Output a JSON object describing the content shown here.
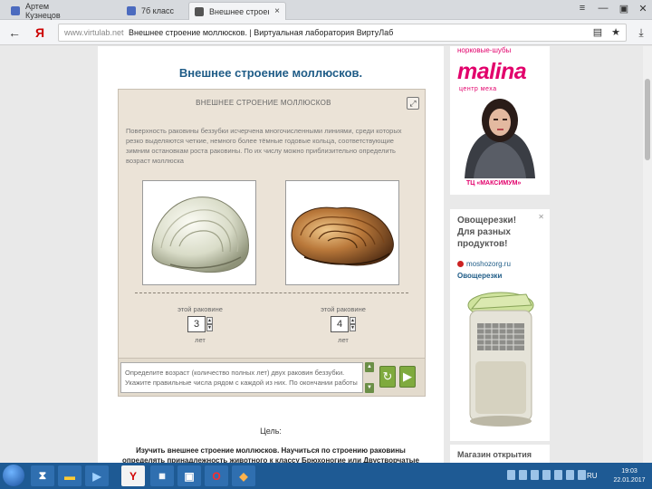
{
  "tabs": [
    {
      "label": "Артем Кузнецов",
      "color": "#4c6bbf"
    },
    {
      "label": "7б класс",
      "color": "#4c6bbf"
    },
    {
      "label": "Внешнее строение молл",
      "color": "#555555"
    }
  ],
  "window_icons": {
    "menu": "≡",
    "minimize": "—",
    "restore": "▣",
    "close": "✕"
  },
  "address": {
    "domain": "www.virtulab.net",
    "page_title": "Внешнее строение моллюсков. | Виртуальная лаборатория ВиртуЛаб"
  },
  "page": {
    "heading": "Внешнее строение моллюсков.",
    "lab": {
      "title": "ВНЕШНЕЕ СТРОЕНИЕ МОЛЛЮСКОВ",
      "description": "Поверхность раковины беззубки исчерчена многочисленными линиями, среди которых резко выделяются четкие, немного более тёмные годовые кольца, соответствующие зимним остановкам роста раковины. По их числу можно приблизительно определить возраст моллюска",
      "shells": [
        {
          "label": "этой раковине",
          "value": "3",
          "unit": "лет"
        },
        {
          "label": "этой раковине",
          "value": "4",
          "unit": "лет"
        }
      ],
      "instruction": "Определите возраст (количество полных лет) двух раковин беззубки. Укажите правильные числа рядом с каждой из них. По окончании работы"
    },
    "goal_label": "Цель:",
    "goal_text": "Изучить внешнее строение моллюсков. Научиться по строению раковины определять принадлежность животного к классу Брюхоногие или Двустворчатые моллюски. Научиться"
  },
  "ads": {
    "ad1": {
      "top": "норковые-шубы",
      "brand": "malina",
      "sub": "центр меха",
      "caption": "ТЦ «МАКСИМУМ»"
    },
    "ad2": {
      "title": "Овощерезки! Для разных продуктов!",
      "site": "moshozorg.ru",
      "name": "Овощерезки"
    },
    "ad3": {
      "title": "Магазин открытия"
    }
  },
  "taskbar": {
    "lang": "RU",
    "time": "19:03",
    "date": "22.01.2017"
  },
  "colors": {
    "accent": "#1f5c87",
    "ad_pink": "#e2006b",
    "taskbar": "#1e5a94",
    "lab_bg": "#ebe3d7",
    "green_btn": "#7faa3e"
  }
}
